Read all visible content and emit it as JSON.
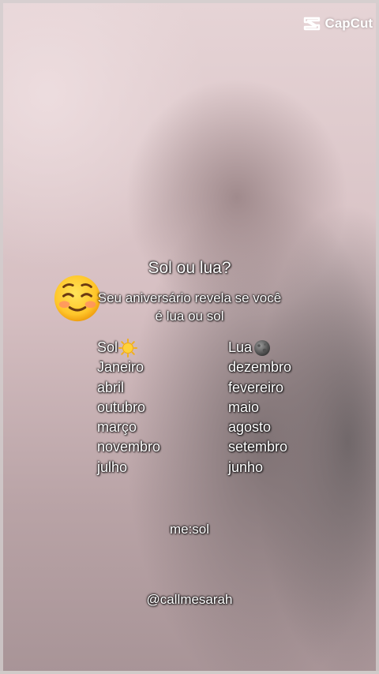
{
  "watermark": {
    "brand": "CapCut",
    "icon": "capcut-logo-icon"
  },
  "title": "Sol ou lua?",
  "subtitle": {
    "line1": "Seu aniversário revela se você",
    "line2": "é lua ou sol",
    "emoji": "smiling-face-emoji"
  },
  "sol": {
    "heading": "Sol",
    "icon": "sun-emoji",
    "months": [
      "Janeiro",
      "abril",
      "outubro",
      "março",
      "novembro",
      "julho"
    ]
  },
  "lua": {
    "heading": "Lua",
    "icon": "new-moon-emoji",
    "months": [
      "dezembro",
      "fevereiro",
      "maio",
      "agosto",
      "setembro",
      "junho"
    ]
  },
  "answer": "me:sol",
  "handle": "@callmesarah",
  "colors": {
    "text": "#ffffff",
    "text_outline": "#000000",
    "background": "#d8c3c6"
  }
}
